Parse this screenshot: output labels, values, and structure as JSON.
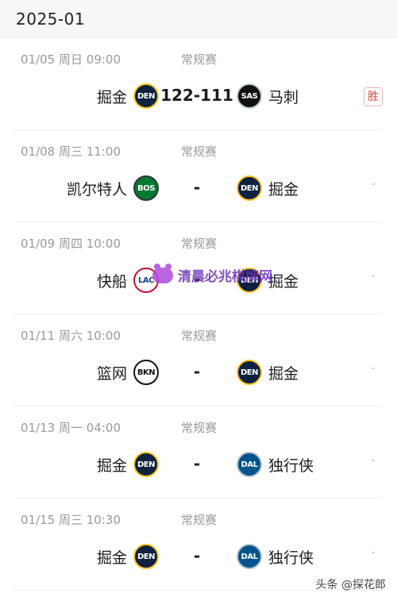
{
  "header": {
    "month": "2025-01"
  },
  "matches": [
    {
      "meta": "01/05  周日 09:00",
      "type": "常规赛",
      "home": "掘金",
      "home_logo": "DEN",
      "score": "122-111",
      "away": "马刺",
      "away_logo": "SAS",
      "result": "胜"
    },
    {
      "meta": "01/08  周三 11:00",
      "type": "常规赛",
      "home": "凯尔特人",
      "home_logo": "BOS",
      "score": "-",
      "away": "掘金",
      "away_logo": "DEN",
      "result": "-"
    },
    {
      "meta": "01/09  周四 10:00",
      "type": "常规赛",
      "home": "快船",
      "home_logo": "LAC",
      "score": "-",
      "away": "掘金",
      "away_logo": "DEN",
      "result": "-"
    },
    {
      "meta": "01/11  周六 10:00",
      "type": "常规赛",
      "home": "篮网",
      "home_logo": "BKN",
      "score": "-",
      "away": "掘金",
      "away_logo": "DEN",
      "result": "-"
    },
    {
      "meta": "01/13  周一 04:00",
      "type": "常规赛",
      "home": "掘金",
      "home_logo": "DEN",
      "score": "-",
      "away": "独行侠",
      "away_logo": "DAL",
      "result": "-"
    },
    {
      "meta": "01/15  周三 10:30",
      "type": "常规赛",
      "home": "掘金",
      "home_logo": "DEN",
      "score": "-",
      "away": "独行侠",
      "away_logo": "DAL",
      "result": "-"
    }
  ],
  "watermark": {
    "text": "清晨必兆棋牌网"
  },
  "footer": {
    "credit": "头条 @探花郎"
  },
  "colors": {
    "win": "#e0443c",
    "muted": "#9a9a9a"
  }
}
